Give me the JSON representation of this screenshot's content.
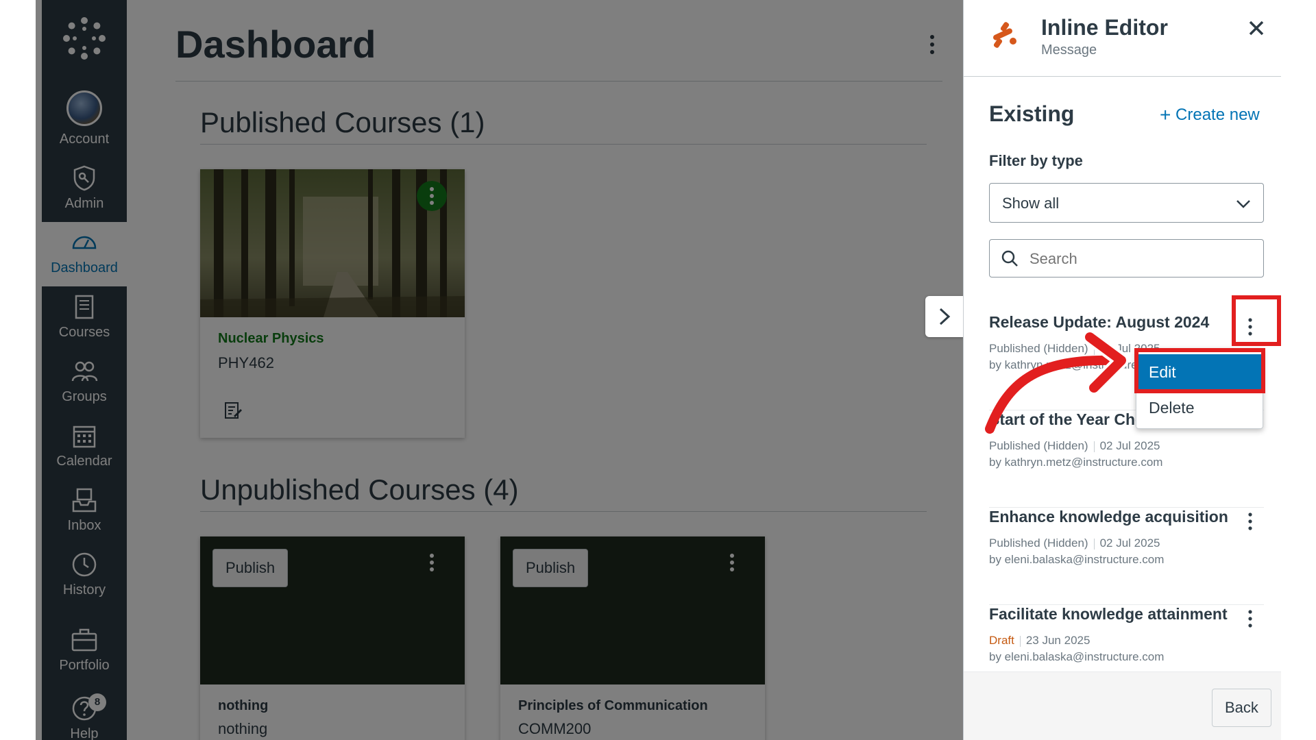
{
  "nav": {
    "items": [
      {
        "label": "Account",
        "icon": "avatar"
      },
      {
        "label": "Admin",
        "icon": "shield-icon"
      },
      {
        "label": "Dashboard",
        "icon": "dashboard-icon"
      },
      {
        "label": "Courses",
        "icon": "book-icon"
      },
      {
        "label": "Groups",
        "icon": "groups-icon"
      },
      {
        "label": "Calendar",
        "icon": "calendar-icon"
      },
      {
        "label": "Inbox",
        "icon": "inbox-icon"
      },
      {
        "label": "History",
        "icon": "clock-icon"
      },
      {
        "label": "Portfolio",
        "icon": "briefcase-icon"
      },
      {
        "label": "Help",
        "icon": "help-icon",
        "badge": "8"
      }
    ]
  },
  "main": {
    "title": "Dashboard",
    "published": {
      "heading": "Published Courses (1)",
      "courses": [
        {
          "name": "Nuclear Physics",
          "code": "PHY462",
          "color": "#127a1b"
        }
      ]
    },
    "unpublished": {
      "heading": "Unpublished Courses (4)",
      "publish_label": "Publish",
      "courses": [
        {
          "name": "nothing",
          "code": "nothing"
        },
        {
          "name": "Principles of Communication",
          "code": "COMM200"
        }
      ]
    }
  },
  "tray": {
    "title": "Inline Editor",
    "subtitle": "Message",
    "existing_heading": "Existing",
    "create_new": "Create new",
    "filter_label": "Filter by type",
    "filter_value": "Show all",
    "search_placeholder": "Search",
    "messages": [
      {
        "title": "Release Update: August 2024",
        "status": "Published (Hidden)",
        "date": "14 Jul 2025",
        "author": "by kathryn.metz@instructure.com"
      },
      {
        "title": "Start of the Year Check-in",
        "status": "Published (Hidden)",
        "date": "02 Jul 2025",
        "author": "by kathryn.metz@instructure.com"
      },
      {
        "title": "Enhance knowledge acquisition",
        "status": "Published (Hidden)",
        "date": "02 Jul 2025",
        "author": "by eleni.balaska@instructure.com"
      },
      {
        "title": "Facilitate knowledge attainment",
        "status": "Draft",
        "date": "23 Jun 2025",
        "author": "by eleni.balaska@instructure.com"
      }
    ],
    "menu": {
      "edit": "Edit",
      "delete": "Delete"
    },
    "back": "Back"
  },
  "colors": {
    "nav_bg": "#2d3b45",
    "accent": "#0374b5",
    "highlight": "#e21f1f",
    "draft": "#c55a11"
  }
}
